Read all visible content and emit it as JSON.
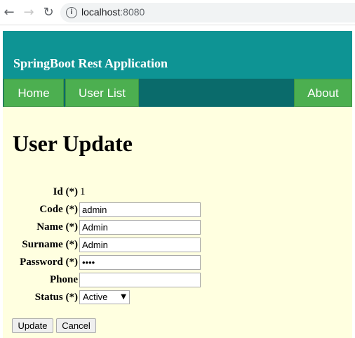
{
  "browser": {
    "url_host": "localhost",
    "url_port": ":8080",
    "back_icon": "←",
    "forward_icon": "→",
    "reload_icon": "↻",
    "info_icon": "i"
  },
  "header": {
    "title": "SpringBoot Rest Application"
  },
  "nav": {
    "home": "Home",
    "user_list": "User List",
    "about": "About"
  },
  "main": {
    "title": "User Update"
  },
  "form": {
    "id_label": "Id (*)",
    "id_value": "1",
    "code_label": "Code (*)",
    "code_value": "admin",
    "name_label": "Name (*)",
    "name_value": "Admin",
    "surname_label": "Surname (*)",
    "surname_value": "Admin",
    "password_label": "Password (*)",
    "password_value": "••••",
    "phone_label": "Phone",
    "phone_value": "",
    "status_label": "Status (*)",
    "status_value": "Active",
    "status_arrow": "▼"
  },
  "buttons": {
    "update": "Update",
    "cancel": "Cancel"
  },
  "colors": {
    "header_bg": "#0e9494",
    "navbar_bg": "#0a6b6b",
    "nav_item_bg": "#4caf50",
    "page_bg": "#ffffe0"
  }
}
